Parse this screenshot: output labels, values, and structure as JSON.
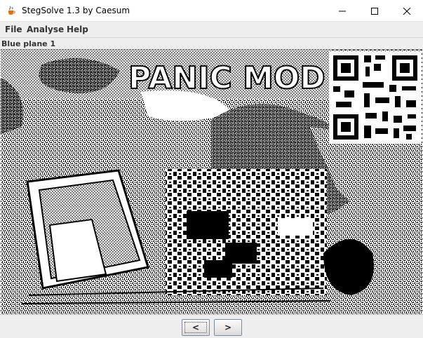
{
  "window": {
    "title": "StegSolve 1.3 by Caesum",
    "icon": "java-cup-icon",
    "controls": [
      "minimize-icon",
      "maximize-icon",
      "close-icon"
    ]
  },
  "menu": {
    "file": "File",
    "analyse": "Analyse",
    "help": "Help"
  },
  "plane": {
    "label": "Blue plane 1"
  },
  "image": {
    "overlay_text": "PANIC MOD",
    "contains_qr": true,
    "colors": {
      "fg": "#000000",
      "bg": "#ffffff"
    }
  },
  "nav": {
    "prev_label": "<",
    "next_label": ">"
  }
}
